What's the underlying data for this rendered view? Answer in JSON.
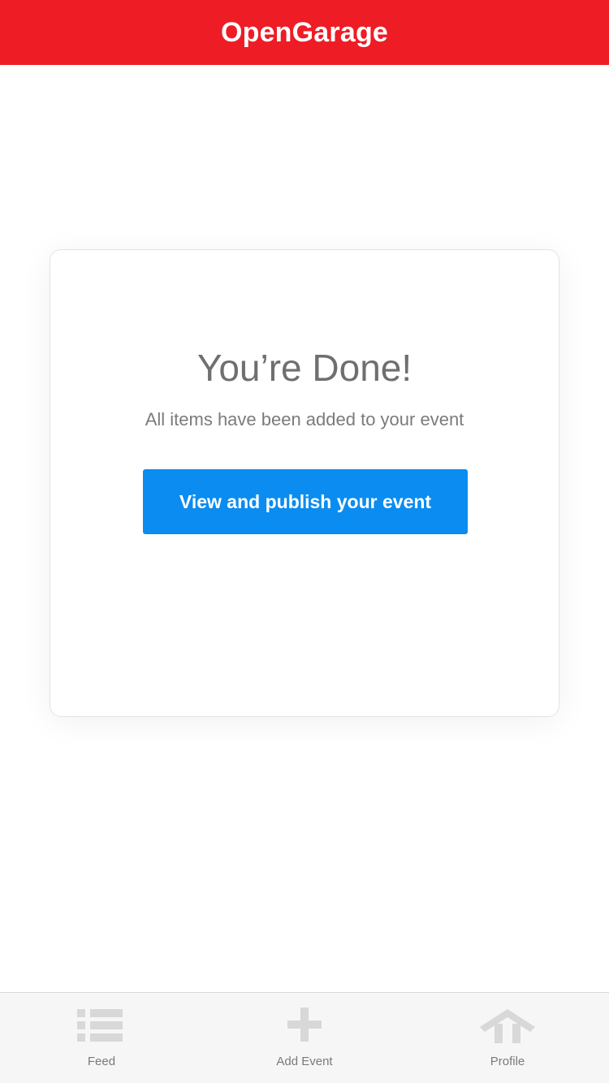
{
  "header": {
    "title": "OpenGarage",
    "background_color": "#ee1c25"
  },
  "card": {
    "title": "You’re Done!",
    "subtitle": "All items have been added to your event",
    "button_label": "View and publish your event",
    "button_color": "#0a8cf0"
  },
  "tabbar": {
    "items": [
      {
        "label": "Feed",
        "icon": "list-icon"
      },
      {
        "label": "Add Event",
        "icon": "plus-icon"
      },
      {
        "label": "Profile",
        "icon": "house-icon"
      }
    ],
    "icon_color": "#d8d8d8"
  }
}
